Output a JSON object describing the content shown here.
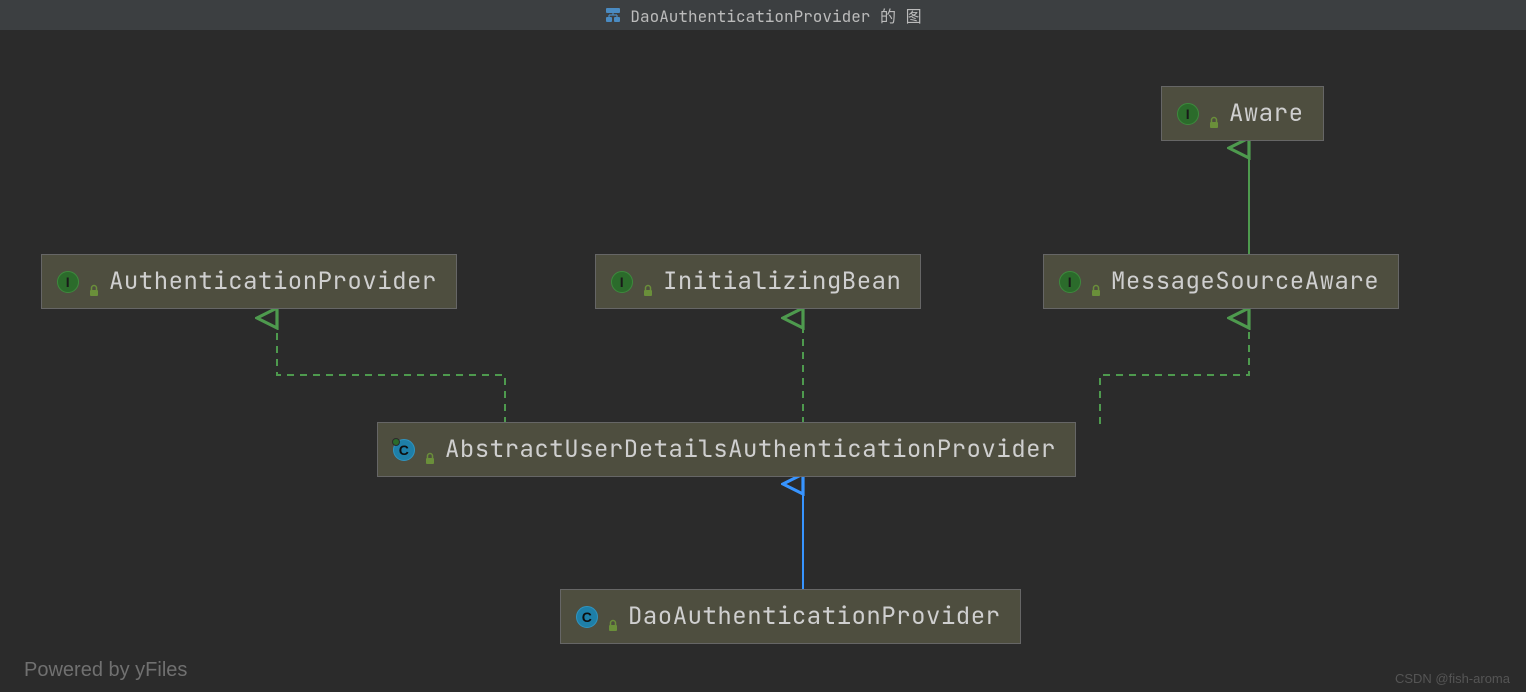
{
  "title": "DaoAuthenticationProvider 的 图",
  "nodes": {
    "aware": {
      "label": "Aware",
      "kind": "I"
    },
    "authProvider": {
      "label": "AuthenticationProvider",
      "kind": "I"
    },
    "initBean": {
      "label": "InitializingBean",
      "kind": "I"
    },
    "msgSrcAware": {
      "label": "MessageSourceAware",
      "kind": "I"
    },
    "abstractUdap": {
      "label": "AbstractUserDetailsAuthenticationProvider",
      "kind": "C"
    },
    "daoAuth": {
      "label": "DaoAuthenticationProvider",
      "kind": "C"
    }
  },
  "footer": {
    "powered": "Powered by yFiles",
    "watermark": "CSDN @fish-aroma"
  },
  "chart_data": {
    "type": "class-hierarchy-diagram",
    "nodes": [
      {
        "id": "Aware",
        "kind": "interface"
      },
      {
        "id": "AuthenticationProvider",
        "kind": "interface"
      },
      {
        "id": "InitializingBean",
        "kind": "interface"
      },
      {
        "id": "MessageSourceAware",
        "kind": "interface"
      },
      {
        "id": "AbstractUserDetailsAuthenticationProvider",
        "kind": "abstract-class"
      },
      {
        "id": "DaoAuthenticationProvider",
        "kind": "class"
      }
    ],
    "edges": [
      {
        "from": "MessageSourceAware",
        "to": "Aware",
        "relation": "extends"
      },
      {
        "from": "AbstractUserDetailsAuthenticationProvider",
        "to": "AuthenticationProvider",
        "relation": "implements"
      },
      {
        "from": "AbstractUserDetailsAuthenticationProvider",
        "to": "InitializingBean",
        "relation": "implements"
      },
      {
        "from": "AbstractUserDetailsAuthenticationProvider",
        "to": "MessageSourceAware",
        "relation": "implements"
      },
      {
        "from": "DaoAuthenticationProvider",
        "to": "AbstractUserDetailsAuthenticationProvider",
        "relation": "extends"
      }
    ]
  }
}
